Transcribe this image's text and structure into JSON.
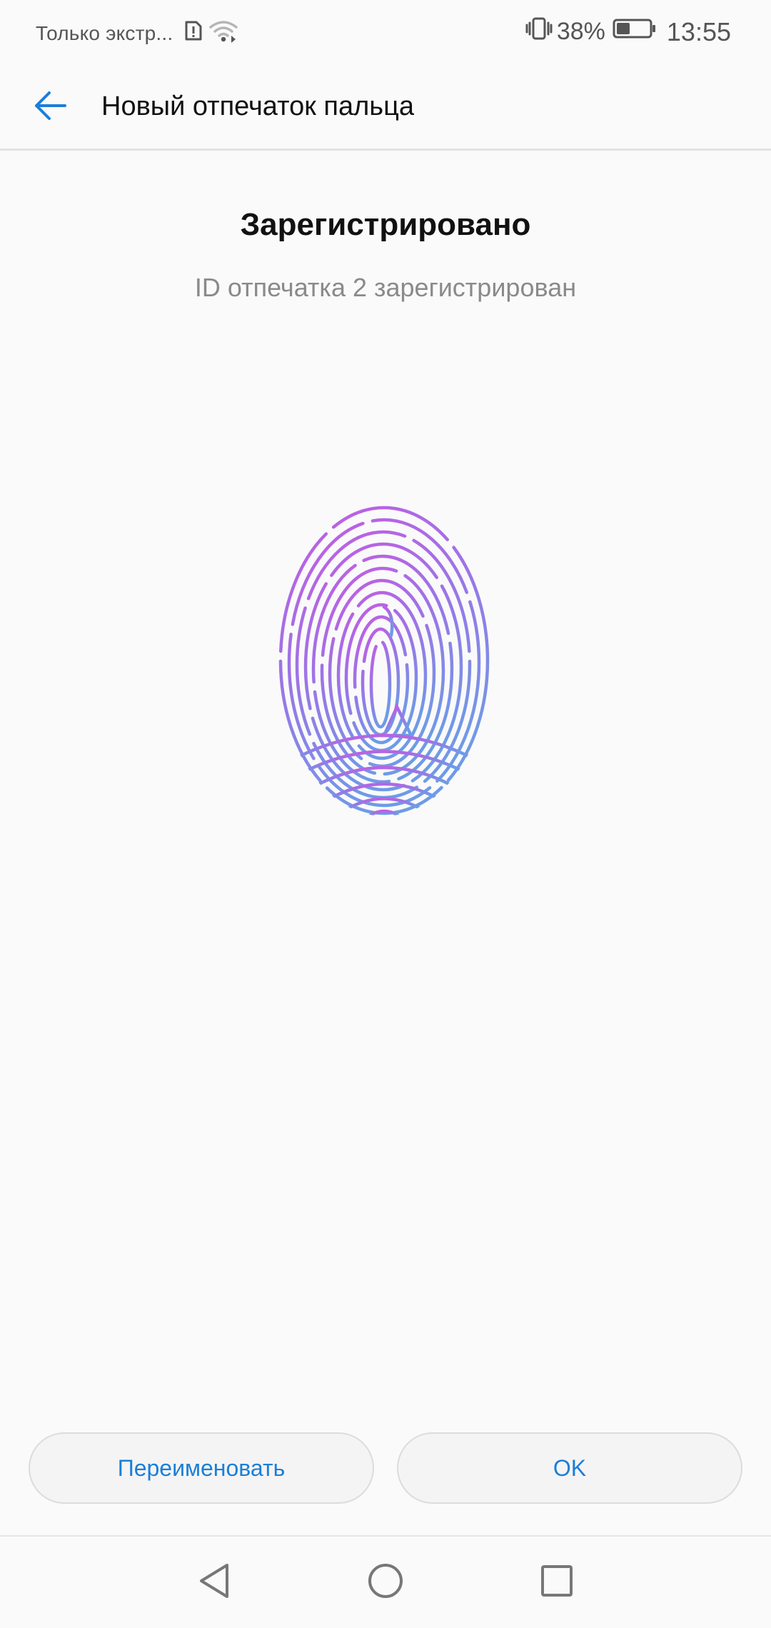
{
  "status_bar": {
    "carrier": "Только экстр...",
    "battery_percent": "38%",
    "time": "13:55",
    "icons": [
      "sim-alert-icon",
      "wifi-icon",
      "vibrate-icon",
      "battery-icon"
    ]
  },
  "app_bar": {
    "back_icon": "arrow-left-icon",
    "title": "Новый отпечаток пальца"
  },
  "content": {
    "headline": "Зарегистрировано",
    "subline": "ID отпечатка 2 зарегистрирован",
    "illustration": "fingerprint-icon"
  },
  "actions": {
    "rename_label": "Переименовать",
    "ok_label": "OK"
  },
  "nav_bar": {
    "icons": [
      "nav-back-icon",
      "nav-home-icon",
      "nav-recents-icon"
    ]
  },
  "colors": {
    "accent": "#1a7fd8",
    "fingerprint_top": "#c05ae4",
    "fingerprint_bottom": "#6f9ae8",
    "background": "#fafafa"
  }
}
